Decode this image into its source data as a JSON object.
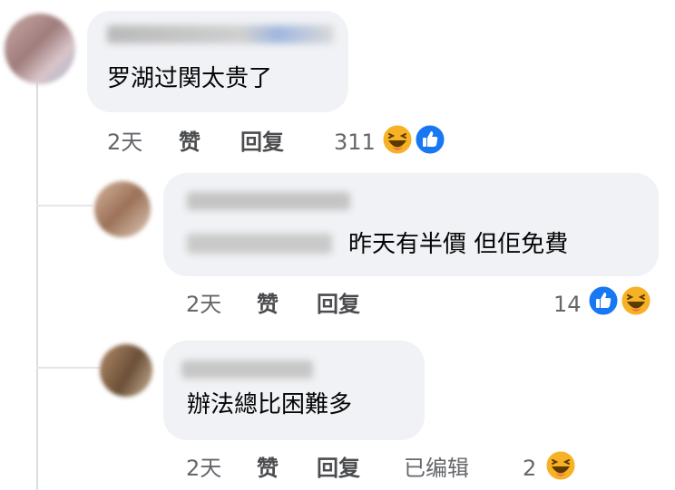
{
  "comments": [
    {
      "text": "罗湖过関太贵了",
      "time": "2天",
      "like_label": "赞",
      "reply_label": "回复",
      "reaction_count": "311",
      "reactions": [
        "haha-icon",
        "like-icon"
      ]
    },
    {
      "text": "昨天有半價 但佢免費",
      "time": "2天",
      "like_label": "赞",
      "reply_label": "回复",
      "reaction_count": "14",
      "reactions": [
        "like-icon",
        "haha-icon"
      ]
    },
    {
      "text": "辦法總比困難多",
      "time": "2天",
      "like_label": "赞",
      "reply_label": "回复",
      "edited_label": "已编辑",
      "reaction_count": "2",
      "reactions": [
        "haha-icon"
      ]
    }
  ],
  "colors": {
    "bubble": "#f0f2f5",
    "meta_text": "#65676b",
    "like_blue": "#1877f2",
    "haha_yellow": "#f7b125"
  }
}
